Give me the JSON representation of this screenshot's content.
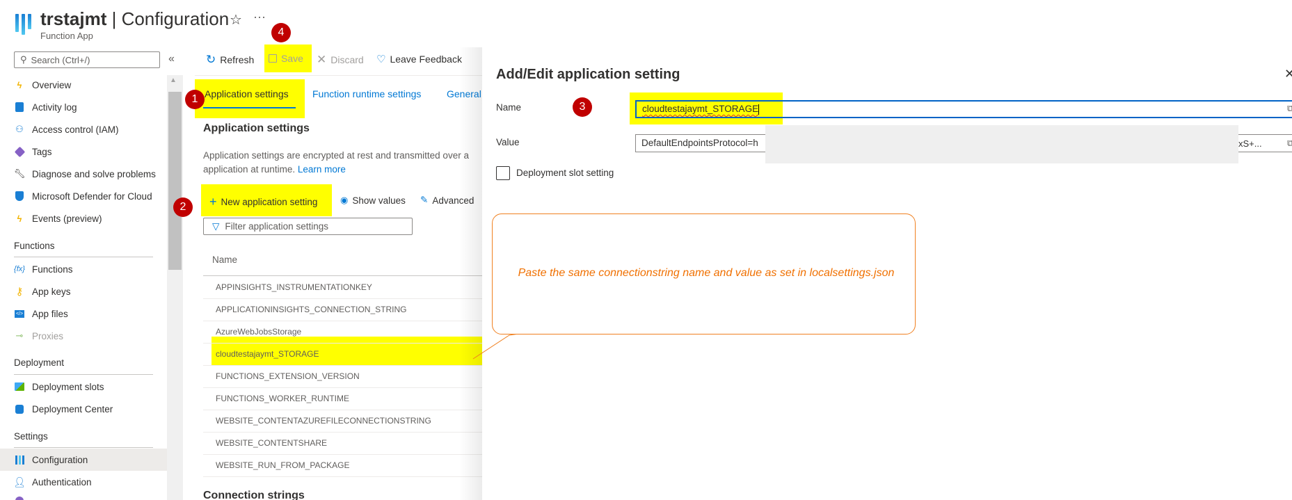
{
  "header": {
    "resource_name": "trstajmt",
    "separator": " | ",
    "page_title": "Configuration",
    "subtitle": "Function App",
    "favorite_icon": "☆",
    "more_icon": "···"
  },
  "sidebar": {
    "search_placeholder": "Search (Ctrl+/)",
    "collapse_icon": "«",
    "top_items": [
      {
        "label": "Overview",
        "icon": "function-bolt-icon"
      },
      {
        "label": "Activity log",
        "icon": "activity-log-icon"
      },
      {
        "label": "Access control (IAM)",
        "icon": "people-icon"
      },
      {
        "label": "Tags",
        "icon": "tag-icon"
      },
      {
        "label": "Diagnose and solve problems",
        "icon": "wrench-icon"
      },
      {
        "label": "Microsoft Defender for Cloud",
        "icon": "shield-icon"
      },
      {
        "label": "Events (preview)",
        "icon": "lightning-icon"
      }
    ],
    "sections": [
      {
        "title": "Functions",
        "items": [
          {
            "label": "Functions",
            "icon": "fx-icon"
          },
          {
            "label": "App keys",
            "icon": "key-icon"
          },
          {
            "label": "App files",
            "icon": "code-file-icon"
          },
          {
            "label": "Proxies",
            "icon": "proxy-icon",
            "disabled": true
          }
        ]
      },
      {
        "title": "Deployment",
        "items": [
          {
            "label": "Deployment slots",
            "icon": "slots-icon"
          },
          {
            "label": "Deployment Center",
            "icon": "cube-icon"
          }
        ]
      },
      {
        "title": "Settings",
        "items": [
          {
            "label": "Configuration",
            "icon": "configuration-icon",
            "active": true
          },
          {
            "label": "Authentication",
            "icon": "user-key-icon"
          }
        ]
      }
    ]
  },
  "toolbar": {
    "refresh": "Refresh",
    "save": "Save",
    "discard": "Discard",
    "feedback": "Leave Feedback"
  },
  "tabs": [
    {
      "label": "Application settings",
      "active": true
    },
    {
      "label": "Function runtime settings"
    },
    {
      "label": "General"
    }
  ],
  "app_settings": {
    "heading": "Application settings",
    "description_1": "Application settings are encrypted at rest and transmitted over a",
    "description_2": "application at runtime. ",
    "learn_more": "Learn more",
    "new_setting": "New application setting",
    "show_values": "Show values",
    "advanced_edit": "Advanced",
    "filter_placeholder": "Filter application settings",
    "column_name": "Name",
    "rows": [
      "APPINSIGHTS_INSTRUMENTATIONKEY",
      "APPLICATIONINSIGHTS_CONNECTION_STRING",
      "AzureWebJobsStorage",
      "cloudtestajaymt_STORAGE",
      "FUNCTIONS_EXTENSION_VERSION",
      "FUNCTIONS_WORKER_RUNTIME",
      "WEBSITE_CONTENTAZUREFILECONNECTIONSTRING",
      "WEBSITE_CONTENTSHARE",
      "WEBSITE_RUN_FROM_PACKAGE"
    ],
    "highlighted_row": "cloudtestajaymt_STORAGE"
  },
  "connection_strings": {
    "heading": "Connection strings"
  },
  "panel": {
    "title": "Add/Edit application setting",
    "close_icon": "✕",
    "name_label": "Name",
    "name_value": "cloudtestajaymt_STORAGE",
    "value_label": "Value",
    "value_prefix": "DefaultEndpointsProtocol=h",
    "value_suffix": "xS+...",
    "slot_setting_label": "Deployment slot setting",
    "slot_setting_checked": false
  },
  "annotations": {
    "badges": [
      "1",
      "2",
      "3",
      "4"
    ],
    "callout_text": "Paste the same connectionstring name and value as set in localsettings.json",
    "highlight_color": "#ffff00",
    "badge_color": "#c00000",
    "callout_color": "#f07000"
  }
}
